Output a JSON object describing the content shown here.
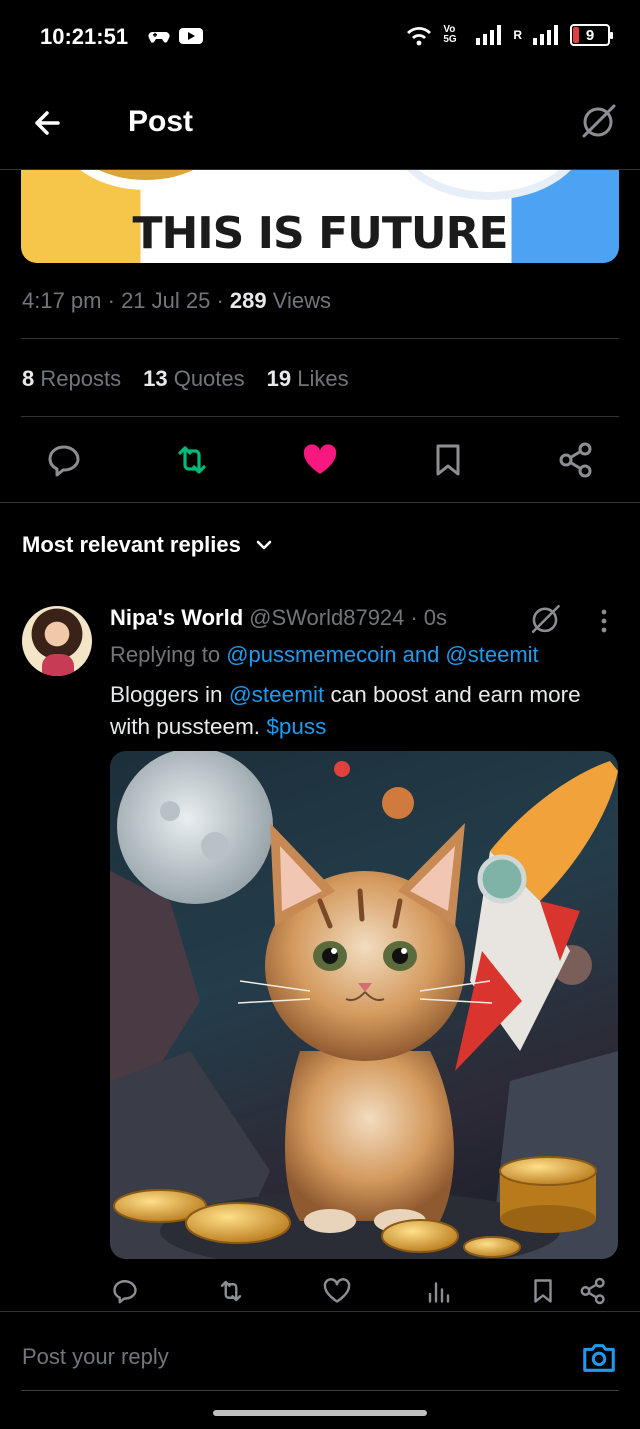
{
  "status_bar": {
    "time": "10:21:51",
    "network_label": "Vo 5G",
    "roaming_label": "R",
    "battery": "9",
    "battery_color": "#e0413d"
  },
  "header": {
    "title": "Post",
    "back_icon": "arrow-left-icon",
    "grok_icon": "grok-icon"
  },
  "post": {
    "banner_text": "THIS IS FUTURE",
    "time": "4:17 pm",
    "date": "21 Jul 25",
    "views_count": "289",
    "views_label": "Views",
    "reposts_count": "8",
    "reposts_label": "Reposts",
    "quotes_count": "13",
    "quotes_label": "Quotes",
    "likes_count": "19",
    "likes_label": "Likes",
    "liked": true,
    "reposted": true,
    "like_color": "#f91880",
    "repost_color": "#00ba7c"
  },
  "replies": {
    "sort_label": "Most relevant replies",
    "items": [
      {
        "name": "Nipa's World",
        "handle": "@SWorld87924",
        "time": "0s",
        "replying_prefix": "Replying to",
        "replying_to": "@pussmemecoin and @steemit",
        "text_part1": "Bloggers in ",
        "text_mention": "@steemit",
        "text_part2": " can boost and earn more with pussteem. ",
        "text_cashtag": "$puss"
      }
    ]
  },
  "composer": {
    "placeholder": "Post your reply"
  },
  "accent_color": "#1d9bf0"
}
